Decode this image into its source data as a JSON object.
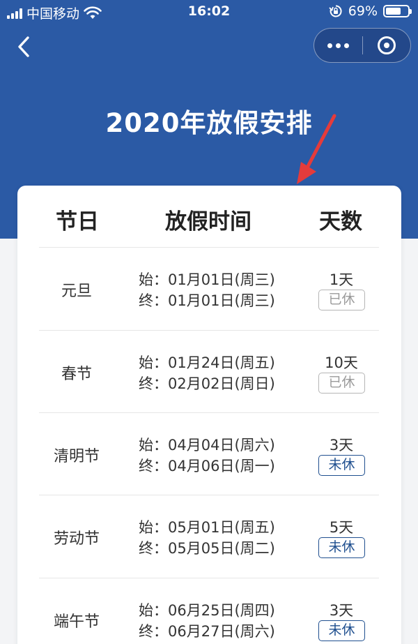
{
  "status_bar": {
    "carrier": "中国移动",
    "time": "16:02",
    "battery": "69%",
    "battery_level": 0.69,
    "icons": [
      "signal-icon",
      "wifi-icon",
      "rotation-lock-icon",
      "battery-icon"
    ]
  },
  "nav": {
    "back_icon": "chevron-left-icon",
    "more_icon": "more-dots-icon",
    "close_icon": "target-circle-icon"
  },
  "page": {
    "title": "2020年放假安排"
  },
  "annotation": {
    "icon": "red-arrow-icon",
    "color": "#e53b3b"
  },
  "table": {
    "headers": {
      "name": "节日",
      "period": "放假时间",
      "days": "天数"
    },
    "rows": [
      {
        "name": "元旦",
        "start": "始：01月01日(周三)",
        "end": "终：01月01日(周三)",
        "days": "1天",
        "status": "已休",
        "state": "rested"
      },
      {
        "name": "春节",
        "start": "始：01月24日(周五)",
        "end": "终：02月02日(周日)",
        "days": "10天",
        "status": "已休",
        "state": "rested"
      },
      {
        "name": "清明节",
        "start": "始：04月04日(周六)",
        "end": "终：04月06日(周一)",
        "days": "3天",
        "status": "未休",
        "state": "pending"
      },
      {
        "name": "劳动节",
        "start": "始：05月01日(周五)",
        "end": "终：05月05日(周二)",
        "days": "5天",
        "status": "未休",
        "state": "pending"
      },
      {
        "name": "端午节",
        "start": "始：06月25日(周四)",
        "end": "终：06月27日(周六)",
        "days": "3天",
        "status": "未休",
        "state": "pending"
      }
    ]
  },
  "colors": {
    "header_bg": "#2b5aa5",
    "page_bg": "#f3f4f6",
    "card_bg": "#ffffff",
    "rested_badge": "#9a9a9a",
    "pending_badge": "#1f4f8f"
  }
}
